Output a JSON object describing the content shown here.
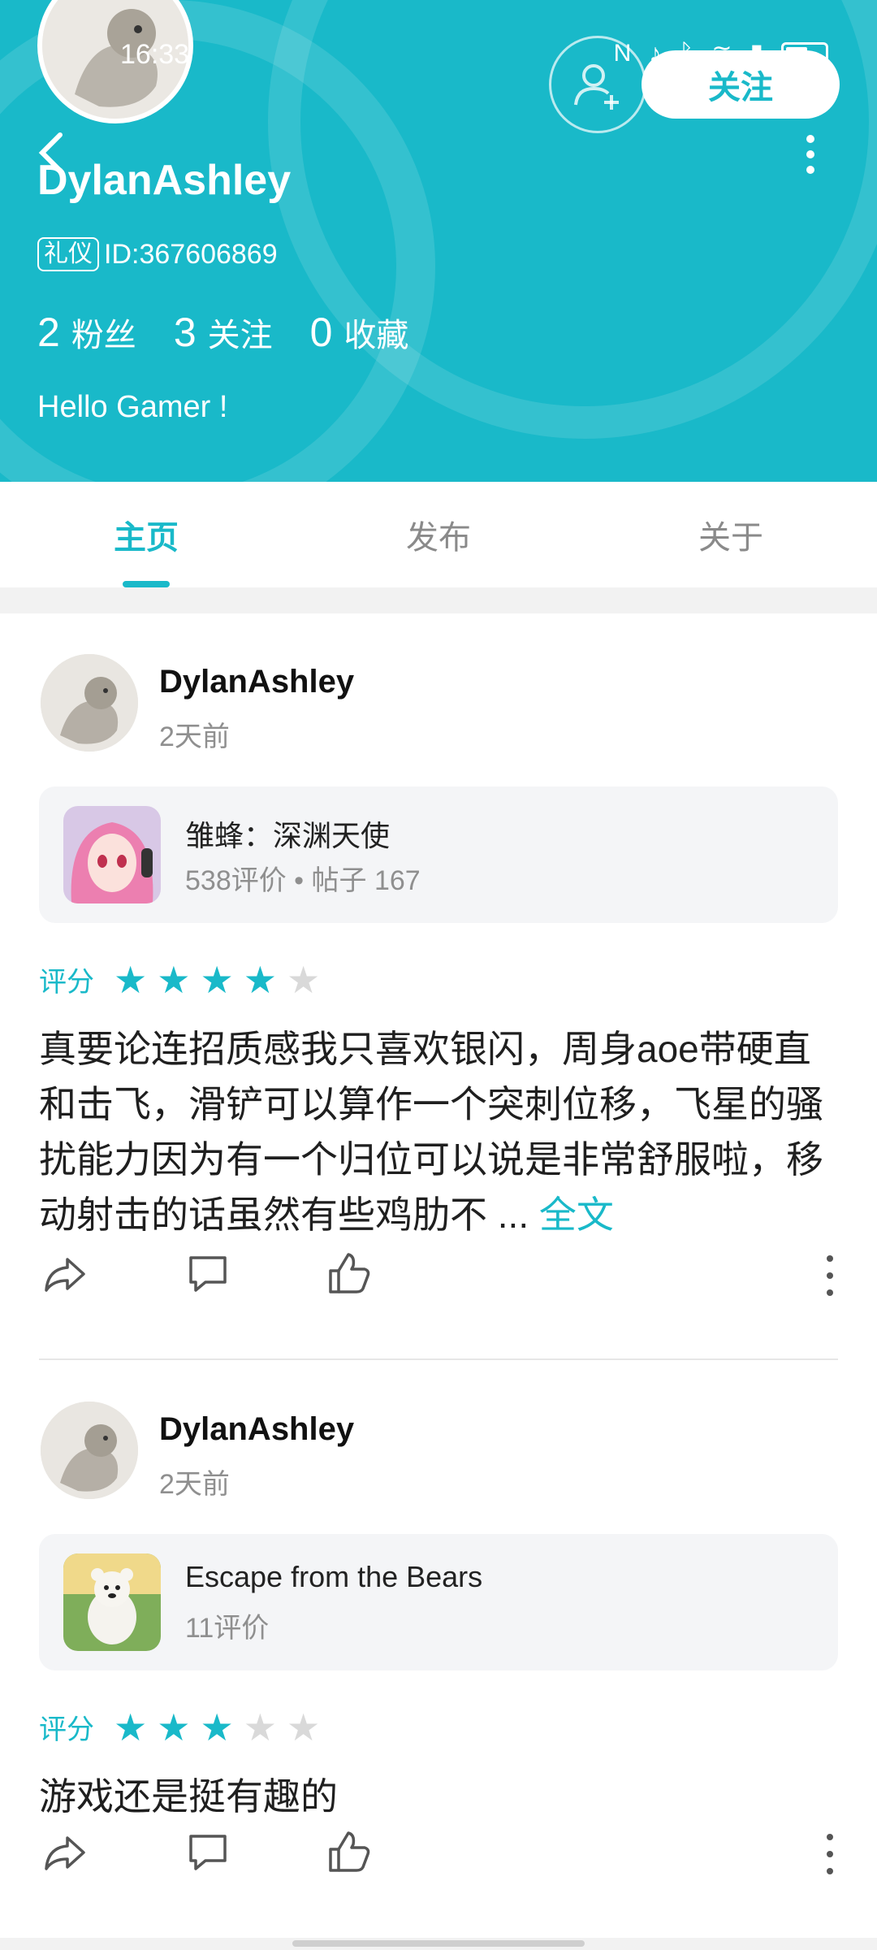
{
  "status_bar": {
    "time": "16:33"
  },
  "profile": {
    "username": "DylanAshley",
    "badge": "礼仪",
    "id_text": "ID:367606869",
    "follow_label": "关注",
    "stats": [
      {
        "num": "2",
        "label": "粉丝"
      },
      {
        "num": "3",
        "label": "关注"
      },
      {
        "num": "0",
        "label": "收藏"
      }
    ],
    "bio": "Hello Gamer !"
  },
  "tabs": [
    {
      "label": "主页",
      "active": true
    },
    {
      "label": "发布",
      "active": false
    },
    {
      "label": "关于",
      "active": false
    }
  ],
  "posts": [
    {
      "author": "DylanAshley",
      "time": "2天前",
      "game_title": "雏蜂：深渊天使",
      "game_meta": "538评价 • 帖子 167",
      "rating_label": "评分",
      "rating": 4,
      "rating_max": 5,
      "text": "真要论连招质感我只喜欢银闪，周身aoe带硬直和击飞，滑铲可以算作一个突刺位移，飞星的骚扰能力因为有一个归位可以说是非常舒服啦，移动射击的话虽然有些鸡肋不 ...",
      "more_link": "全文"
    },
    {
      "author": "DylanAshley",
      "time": "2天前",
      "game_title": "Escape from the Bears",
      "game_meta": "11评价",
      "rating_label": "评分",
      "rating": 3,
      "rating_max": 5,
      "text": "游戏还是挺有趣的",
      "more_link": ""
    }
  ],
  "colors": {
    "accent": "#19b9c9"
  }
}
